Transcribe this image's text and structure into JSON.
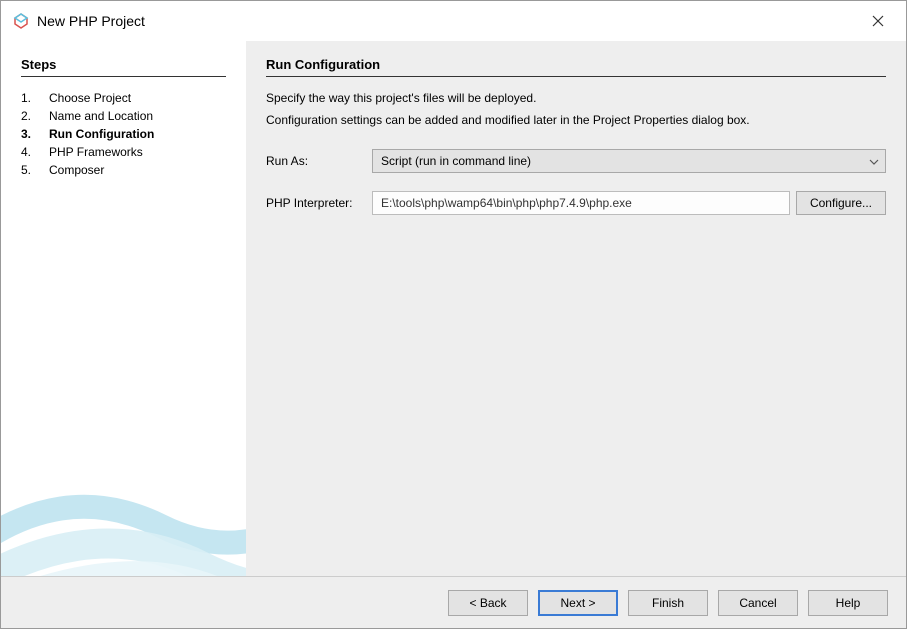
{
  "window": {
    "title": "New PHP Project"
  },
  "sidebar": {
    "heading": "Steps",
    "steps": [
      {
        "num": "1.",
        "label": "Choose Project",
        "current": false
      },
      {
        "num": "2.",
        "label": "Name and Location",
        "current": false
      },
      {
        "num": "3.",
        "label": "Run Configuration",
        "current": true
      },
      {
        "num": "4.",
        "label": "PHP Frameworks",
        "current": false
      },
      {
        "num": "5.",
        "label": "Composer",
        "current": false
      }
    ]
  },
  "main": {
    "heading": "Run Configuration",
    "desc1": "Specify the way this project's files will be deployed.",
    "desc2": "Configuration settings can be added and modified later in the Project Properties dialog box.",
    "run_as_label": "Run As:",
    "run_as_value": "Script (run in command line)",
    "interp_label": "PHP Interpreter:",
    "interp_value": "E:\\tools\\php\\wamp64\\bin\\php\\php7.4.9\\php.exe",
    "configure_label": "Configure..."
  },
  "footer": {
    "back": "< Back",
    "next": "Next >",
    "finish": "Finish",
    "cancel": "Cancel",
    "help": "Help"
  }
}
